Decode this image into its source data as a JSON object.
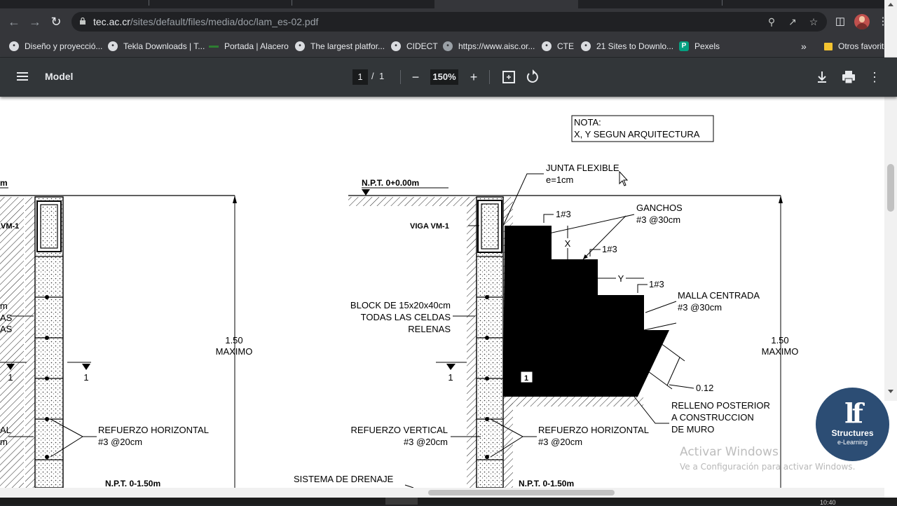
{
  "browser": {
    "url_host": "tec.ac.cr",
    "url_path": "/sites/default/files/media/doc/lam_es-02.pdf",
    "bookmarks": [
      {
        "label": "Diseño y proyecció..."
      },
      {
        "label": "Tekla Downloads | T..."
      },
      {
        "label": "Portada | Alacero"
      },
      {
        "label": "The largest platfor..."
      },
      {
        "label": "CIDECT"
      },
      {
        "label": "https://www.aisc.or..."
      },
      {
        "label": "CTE"
      },
      {
        "label": "21 Sites to Downlo..."
      },
      {
        "label": "Pexels"
      }
    ],
    "other_bookmarks": "Otros favoritos"
  },
  "pdf_toolbar": {
    "title": "Model",
    "page_current": "1",
    "page_sep": "/",
    "page_total": "1",
    "zoom": "150%"
  },
  "drawing": {
    "note_line1": "NOTA:",
    "note_line2": "X, Y SEGUN ARQUITECTURA",
    "junta_line1": "JUNTA FLEXIBLE",
    "junta_line2": "e=1cm",
    "npt_top": "N.P.T. 0+0.00m",
    "npt_bottom": "N.P.T. 0-1.50m",
    "viga": "VIGA VM-1",
    "viga_cut": "VM-1",
    "r1": "1#3",
    "r2": "1#3",
    "r3": "1#3",
    "ganchos_1": "GANCHOS",
    "ganchos_2": "#3 @30cm",
    "dim_x": "X",
    "dim_y": "Y",
    "malla_1": "MALLA CENTRADA",
    "malla_2": "#3 @30cm",
    "block_1": "BLOCK DE 15x20x40cm",
    "block_2": "TODAS LAS CELDAS",
    "block_3": "RELENAS",
    "height_1": "1.50",
    "height_2": "MAXIMO",
    "section_mark": "1",
    "tag": "1",
    "dim_012": "0.12",
    "relleno_1": "RELLENO POSTERIOR",
    "relleno_2": "A CONSTRUCCION",
    "relleno_3": "DE MURO",
    "ref_vert_1": "REFUERZO VERTICAL",
    "ref_vert_2": "#3 @20cm",
    "ref_hor_1": "REFUERZO HORIZONTAL",
    "ref_hor_2": "#3 @20cm",
    "drenaje": "SISTEMA DE DRENAJE",
    "left_m": "m",
    "left_as1": "AS",
    "left_as2": "AS",
    "left_al": "AL",
    "left_m2": "m",
    "left_npt_cut": "m"
  },
  "watermark": {
    "line1": "Activar Windows",
    "line2": "Ve a Configuración para activar Windows."
  },
  "brand": {
    "logo_text": "lf",
    "name": "Structures",
    "sub": "e-Learning"
  },
  "system": {
    "clock": "10:40"
  }
}
